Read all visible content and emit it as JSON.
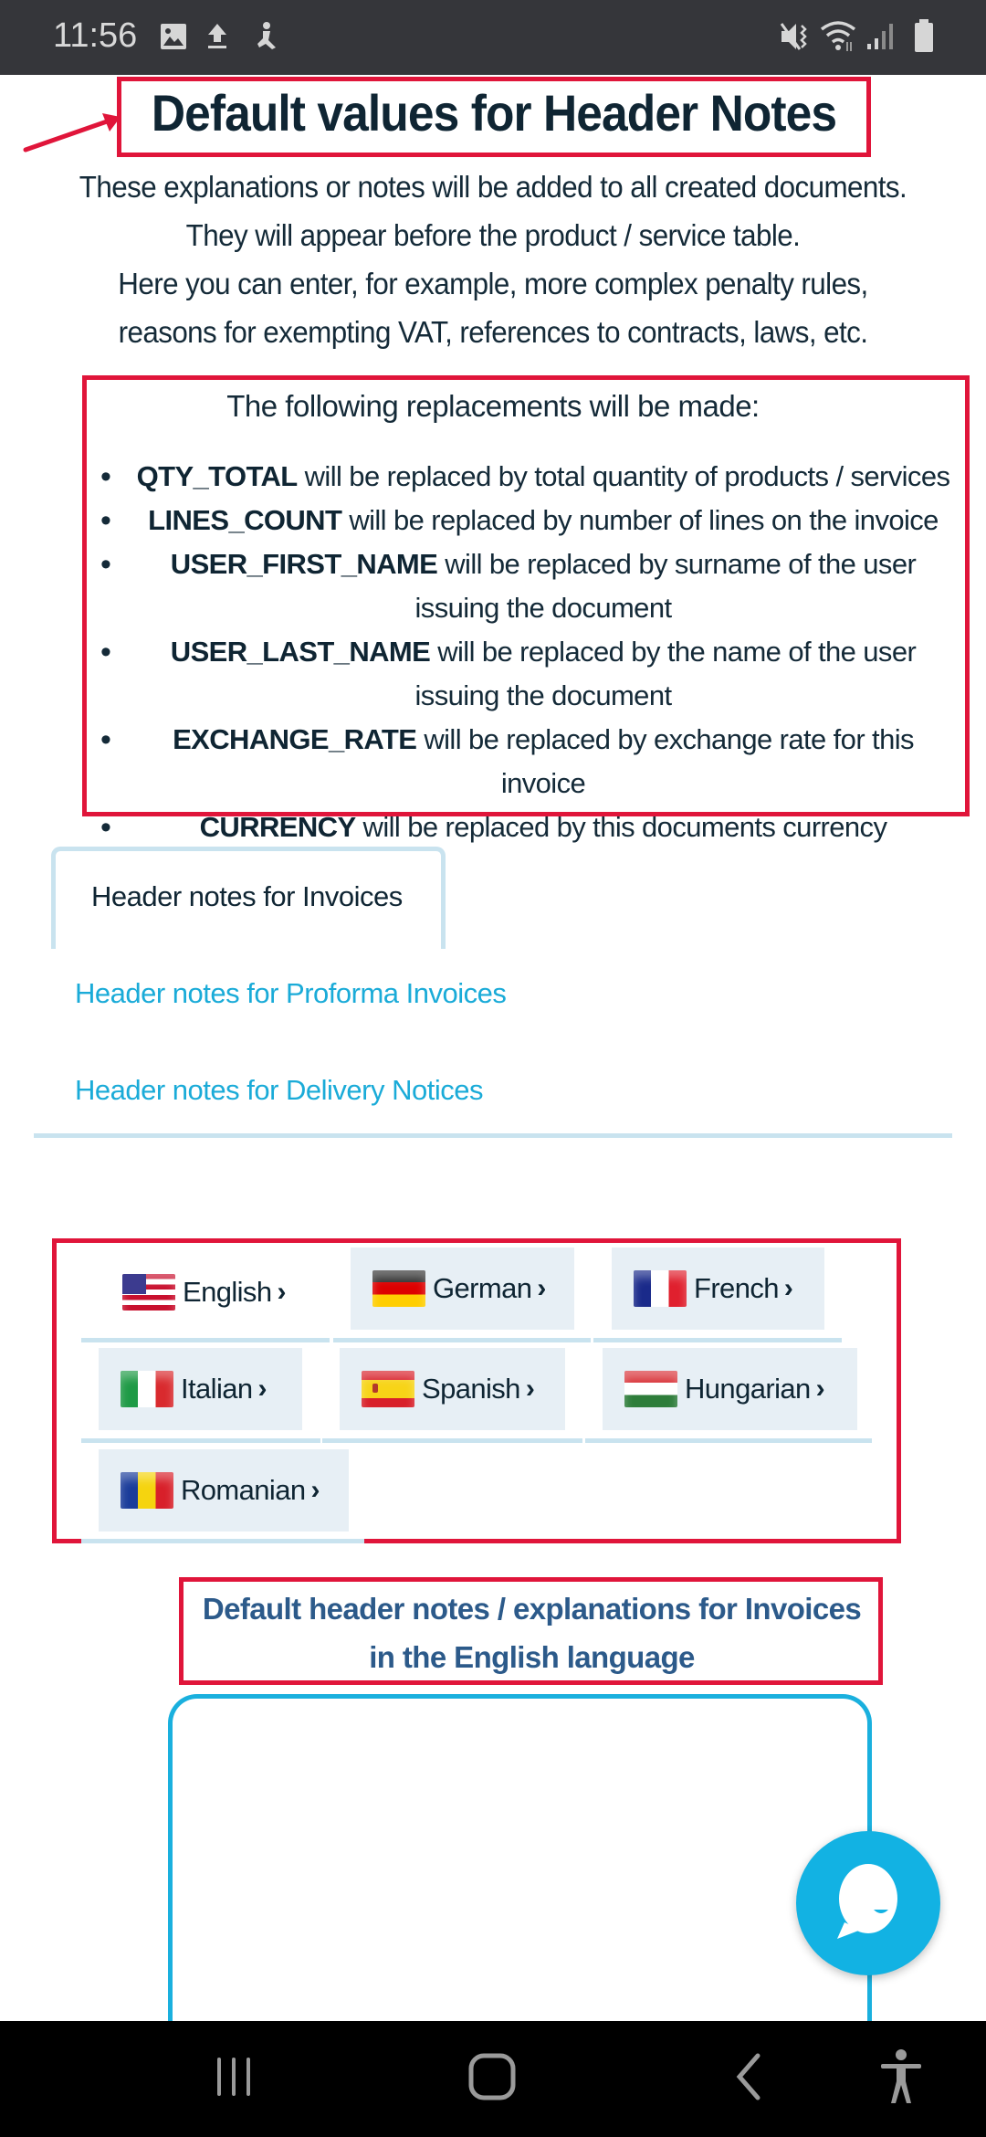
{
  "status_bar": {
    "time": "11:56",
    "left_icons": [
      "image-icon",
      "upload-icon",
      "accessibility-notification-icon"
    ],
    "right_icons": [
      "mute-vibrate-icon",
      "wifi-icon",
      "signal-icon",
      "battery-icon"
    ]
  },
  "page": {
    "title": "Default values for Header Notes",
    "intro_lines": [
      "These explanations or notes will be added to all created documents.",
      "They will appear before the product / service table.",
      "Here you can enter, for example, more complex penalty rules,",
      "reasons for exempting VAT, references to contracts, laws, etc."
    ]
  },
  "replacements": {
    "heading": "The following replacements will be made:",
    "items": [
      {
        "token": "QTY_TOTAL",
        "text": " will be replaced by total quantity of products / services"
      },
      {
        "token": "LINES_COUNT",
        "text": " will be replaced by number of lines on the invoice"
      },
      {
        "token": "USER_FIRST_NAME",
        "text": " will be replaced by surname of the user issuing the document"
      },
      {
        "token": "USER_LAST_NAME",
        "text": " will be replaced by the name of the user issuing the document"
      },
      {
        "token": "EXCHANGE_RATE",
        "text": " will be replaced by exchange rate for this invoice"
      },
      {
        "token": "CURRENCY",
        "text": " will be replaced by this documents currency"
      }
    ]
  },
  "tabs": [
    {
      "label": "Header notes for Invoices",
      "active": true
    },
    {
      "label": "Header notes for Proforma Invoices",
      "active": false
    },
    {
      "label": "Header notes for Delivery Notices",
      "active": false
    }
  ],
  "languages": [
    {
      "label": "English",
      "flag": "us-flag-icon",
      "selected": true
    },
    {
      "label": "German",
      "flag": "germany-flag-icon",
      "selected": false
    },
    {
      "label": "French",
      "flag": "france-flag-icon",
      "selected": false
    },
    {
      "label": "Italian",
      "flag": "italy-flag-icon",
      "selected": false
    },
    {
      "label": "Spanish",
      "flag": "spain-flag-icon",
      "selected": false
    },
    {
      "label": "Hungarian",
      "flag": "hungary-flag-icon",
      "selected": false
    },
    {
      "label": "Romanian",
      "flag": "romania-flag-icon",
      "selected": false
    }
  ],
  "chevron": "›",
  "editor": {
    "heading_line1": "Default header notes / explanations for Invoices",
    "heading_line2": "in the English language",
    "value": ""
  },
  "colors": {
    "annotation_red": "#e0153a",
    "accent_blue": "#1ab0de",
    "link_blue": "#1aabd8",
    "heading_blue": "#2c5a8a",
    "tab_border": "#c9e3ef",
    "button_bg": "#e7eff5",
    "text_dark": "#0f2533"
  },
  "nav_bar": {
    "buttons": [
      "recent-apps",
      "home",
      "back",
      "accessibility"
    ]
  }
}
